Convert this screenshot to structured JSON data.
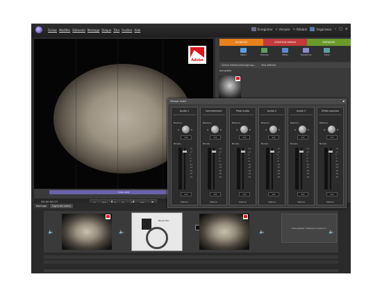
{
  "menu": [
    "Fichier",
    "Modifier",
    "Eléments",
    "Montage",
    "Disque",
    "Titre",
    "Fenêtre",
    "Aide"
  ],
  "topbar": {
    "save_label": "Enregistrer",
    "undo_label": "Annuler",
    "redo_label": "Rétablir",
    "organizer_label": "Organiseur"
  },
  "monitor": {
    "watermark_text": "Adobe",
    "timeline_label": "Vidéo-effet",
    "timecode": "00;00;00;15"
  },
  "transport_buttons": [
    "◄",
    "◄◄",
    "▌◄",
    "►",
    "►▌",
    "►►",
    "▼"
  ],
  "right_panel": {
    "tabs": [
      "MODIFIER",
      "CRÉATION MENUS",
      "PARTAGER"
    ],
    "icons": [
      {
        "label": "Média",
        "icon": "media-icon",
        "color": "#5aa0e0"
      },
      {
        "label": "Thèmes",
        "icon": "themes-icon",
        "color": "#5aa05a"
      },
      {
        "label": "Effets",
        "icon": "effects-icon",
        "color": "#5a8ad0"
      },
      {
        "label": "Transitions",
        "icon": "transitions-icon",
        "color": "#8a8ad0"
      },
      {
        "label": "Titres",
        "icon": "titles-icon",
        "color": "#5aa0a0"
      }
    ],
    "filter_label": "Genre d'événement/group...",
    "show_all_label": "Tout afficher",
    "section_label": "Actualités"
  },
  "mixer": {
    "title": "Mixage audio",
    "channels": [
      {
        "name": "Audio 1",
        "balance": "0.0",
        "level": "0.0"
      },
      {
        "name": "Commentaire",
        "balance": "0.0",
        "level": "0.0"
      },
      {
        "name": "Piste audio",
        "balance": "0.0",
        "level": "0.0"
      },
      {
        "name": "Audio 2",
        "balance": "0.0",
        "level": "0.0"
      },
      {
        "name": "Audio 3",
        "balance": "0.0",
        "level": "0.0"
      },
      {
        "name": "Effets sonores",
        "balance": "0.0",
        "level": "0.0"
      }
    ],
    "balance_label": "Balance",
    "level_label": "Niveau",
    "left_label": "G",
    "right_label": "D",
    "mute_label": "Silence",
    "scale": [
      "+6",
      "+3",
      "0",
      "-3",
      "-6",
      "-10",
      "-15",
      "-20",
      "-30",
      "-40"
    ]
  },
  "bottom": {
    "tabs": [
      "Montage",
      "Ligne de scène"
    ],
    "clip_title": "Blank Film",
    "drop_text": "Faire glisser l'élément suivant ici"
  }
}
